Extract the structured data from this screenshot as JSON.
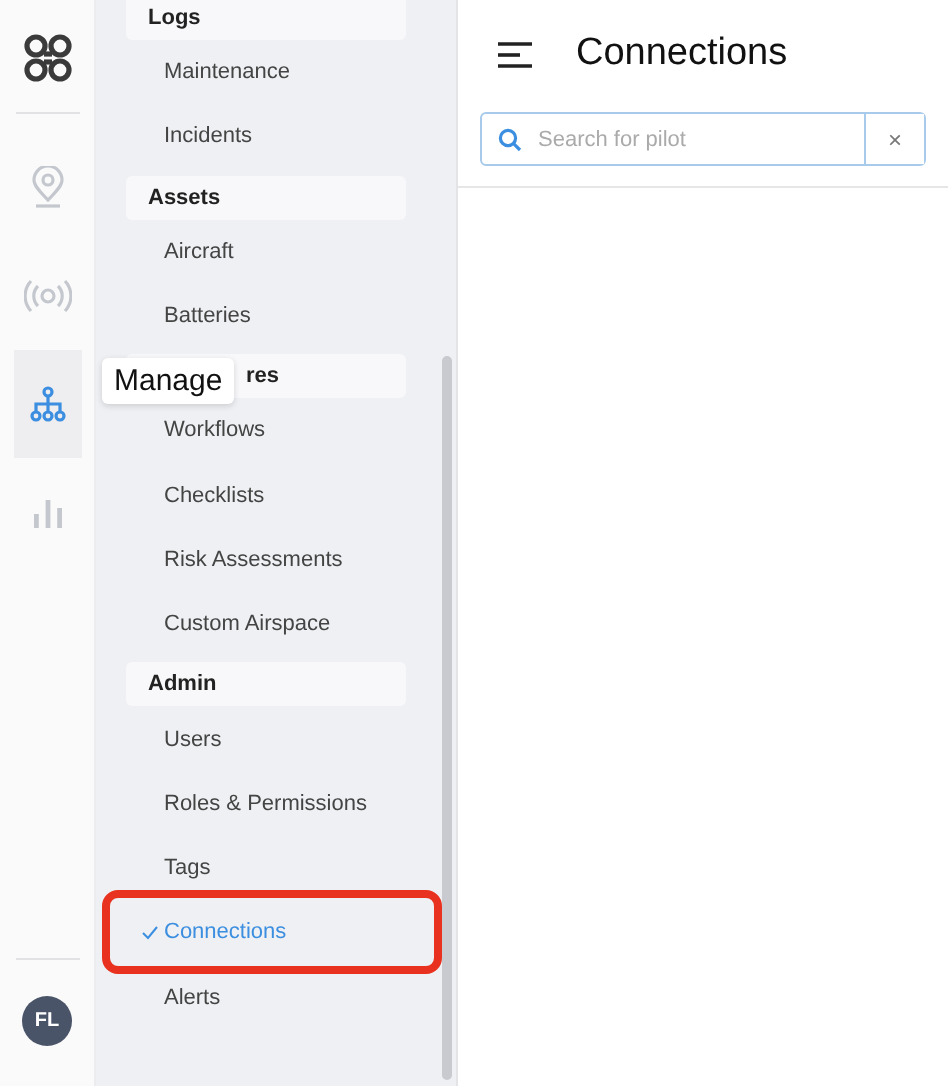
{
  "rail": [
    {
      "kind": "logo",
      "selected": false
    },
    {
      "kind": "pin",
      "selected": false
    },
    {
      "kind": "signal",
      "selected": false
    },
    {
      "kind": "org",
      "selected": true
    },
    {
      "kind": "chart",
      "selected": false
    }
  ],
  "avatar": {
    "initials": "FL"
  },
  "tooltip": {
    "text": "Manage"
  },
  "sidebar": {
    "sections": [
      {
        "label": "Logs",
        "covered": false,
        "items": [
          {
            "label": "Maintenance",
            "selected": false
          },
          {
            "label": "Incidents",
            "selected": false
          }
        ]
      },
      {
        "label": "Assets",
        "covered": false,
        "items": [
          {
            "label": "Aircraft",
            "selected": false
          },
          {
            "label": "Batteries",
            "selected": false
          }
        ]
      },
      {
        "label": "res",
        "covered": true,
        "items": [
          {
            "label": "Workflows",
            "selected": false
          },
          {
            "label": "Checklists",
            "selected": false
          },
          {
            "label": "Risk Assessments",
            "selected": false
          },
          {
            "label": "Custom Airspace",
            "selected": false
          }
        ]
      },
      {
        "label": "Admin",
        "covered": false,
        "items": [
          {
            "label": "Users",
            "selected": false
          },
          {
            "label": "Roles & Permissions",
            "selected": false
          },
          {
            "label": "Tags",
            "selected": false
          },
          {
            "label": "Connections",
            "selected": true
          },
          {
            "label": "Alerts",
            "selected": false
          }
        ]
      }
    ]
  },
  "header": {
    "title": "Connections"
  },
  "search": {
    "placeholder": "Search for pilot",
    "clear": "×"
  }
}
